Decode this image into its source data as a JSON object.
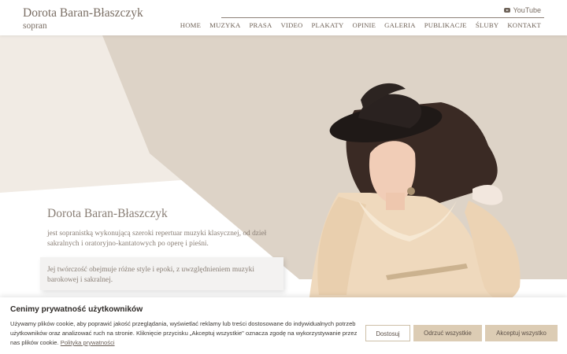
{
  "header": {
    "brand_name": "Dorota Baran-Błaszczyk",
    "brand_subtitle": "sopran",
    "youtube_label": "YouTube",
    "nav": [
      "HOME",
      "MUZYKA",
      "PRASA",
      "VIDEO",
      "PLAKATY",
      "OPINIE",
      "GALERIA",
      "PUBLIKACJE",
      "ŚLUBY",
      "KONTAKT"
    ]
  },
  "hero": {
    "title": "Dorota Baran-Błaszczyk",
    "description": "jest sopranistką wykonującą szeroki repertuar muzyki klasycznej, od dzieł sakralnych i oratoryjno-kantatowych po operę i pieśni.",
    "quote": "Jej twórczość obejmuje różne style i epoki, z uwzględnieniem muzyki barokowej i sakralnej."
  },
  "cookie": {
    "title": "Cenimy prywatność użytkowników",
    "text": "Używamy plików cookie, aby poprawić jakość przeglądania, wyświetlać reklamy lub treści dostosowane do indywidualnych potrzeb użytkowników oraz analizować ruch na stronie. Kliknięcie przycisku „Akceptuj wszystkie\" oznacza zgodę na wykorzystywanie przez nas plików cookie.",
    "link_label": "Polityka prywatności",
    "customize_label": "Dostosuj",
    "reject_label": "Odrzuć wszystkie",
    "accept_label": "Akceptuj wszystko"
  },
  "colors": {
    "beige_light": "#f0e9e2",
    "beige_dark": "#ddd4c8",
    "button_fill": "#dcccb4",
    "text_muted": "#8a7f76"
  }
}
